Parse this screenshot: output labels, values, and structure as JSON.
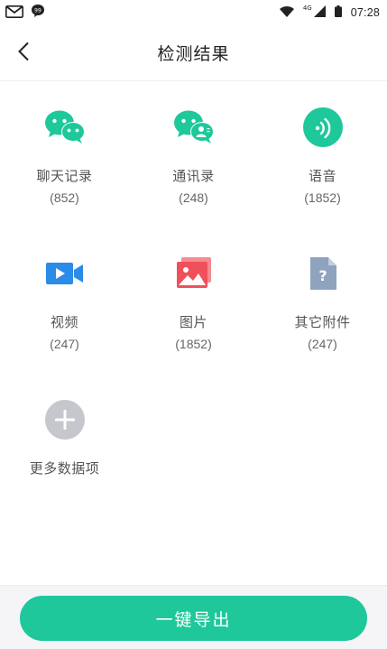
{
  "status_bar": {
    "time": "07:28",
    "network": "4G",
    "icons": [
      "gmail-icon",
      "chat-bubble-icon",
      "wifi-icon",
      "signal-icon",
      "battery-icon"
    ]
  },
  "header": {
    "title": "检测结果",
    "back_icon": "chevron-left-icon"
  },
  "items": [
    {
      "label": "聊天记录",
      "count": "(852)",
      "icon": "wechat-icon"
    },
    {
      "label": "通讯录",
      "count": "(248)",
      "icon": "wechat-contacts-icon"
    },
    {
      "label": "语音",
      "count": "(1852)",
      "icon": "voice-icon"
    },
    {
      "label": "视频",
      "count": "(247)",
      "icon": "video-icon"
    },
    {
      "label": "图片",
      "count": "(1852)",
      "icon": "image-icon"
    },
    {
      "label": "其它附件",
      "count": "(247)",
      "icon": "file-unknown-icon"
    },
    {
      "label": "更多数据项",
      "icon": "add-more-icon"
    }
  ],
  "footer": {
    "export_label": "一键导出"
  },
  "colors": {
    "accent": "#1ec89a",
    "video_blue": "#2a8be8",
    "image_red": "#f0505a",
    "file_gray": "#8fa3bf",
    "add_gray": "#c6c7cc"
  }
}
